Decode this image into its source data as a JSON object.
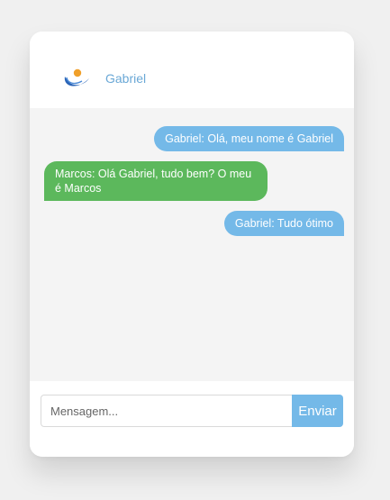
{
  "header": {
    "name": "Gabriel",
    "logo_icon": "logo-icon"
  },
  "messages": [
    {
      "type": "sent",
      "text": "Gabriel: Olá, meu nome é Gabriel"
    },
    {
      "type": "received",
      "text": "Marcos: Olá Gabriel, tudo bem? O meu é Marcos"
    },
    {
      "type": "sent",
      "text": "Gabriel: Tudo ótimo"
    }
  ],
  "composer": {
    "placeholder": "Mensagem...",
    "value": "",
    "send_label": "Enviar"
  },
  "colors": {
    "sent_bubble": "#74b9e8",
    "received_bubble": "#5cb85c",
    "header_name": "#6aa8d6",
    "send_button": "#74b9e8"
  }
}
